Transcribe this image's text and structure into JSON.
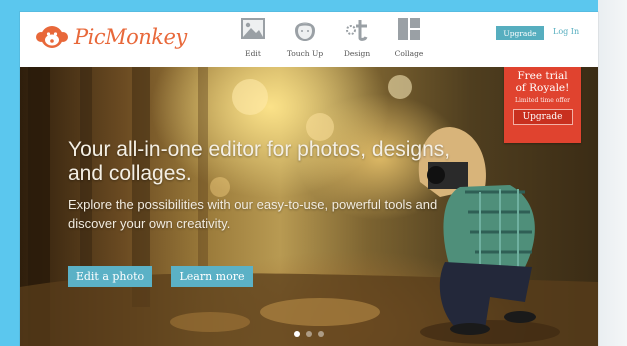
{
  "header": {
    "logo_text": "PicMonkey",
    "nav": [
      {
        "label": "Edit",
        "icon": "image-icon"
      },
      {
        "label": "Touch Up",
        "icon": "face-icon"
      },
      {
        "label": "Design",
        "icon": "design-icon"
      },
      {
        "label": "Collage",
        "icon": "collage-icon"
      }
    ],
    "upgrade_label": "Upgrade",
    "login_label": "Log In"
  },
  "hero": {
    "title": "Your all-in-one editor for photos, designs, and collages.",
    "subtitle": "Explore the possibilities with our easy-to-use, powerful tools and discover your own creativity.",
    "edit_button": "Edit a photo",
    "learn_button": "Learn more",
    "slide_count": 3,
    "active_slide": 1
  },
  "promo": {
    "line1": "Free trial",
    "line2": "of Royale!",
    "line3": "Limited time offer",
    "button": "Upgrade"
  },
  "colors": {
    "background": "#5bc7ee",
    "accent": "#5bb1c6",
    "logo": "#e8683a",
    "promo": "#e0432f"
  }
}
